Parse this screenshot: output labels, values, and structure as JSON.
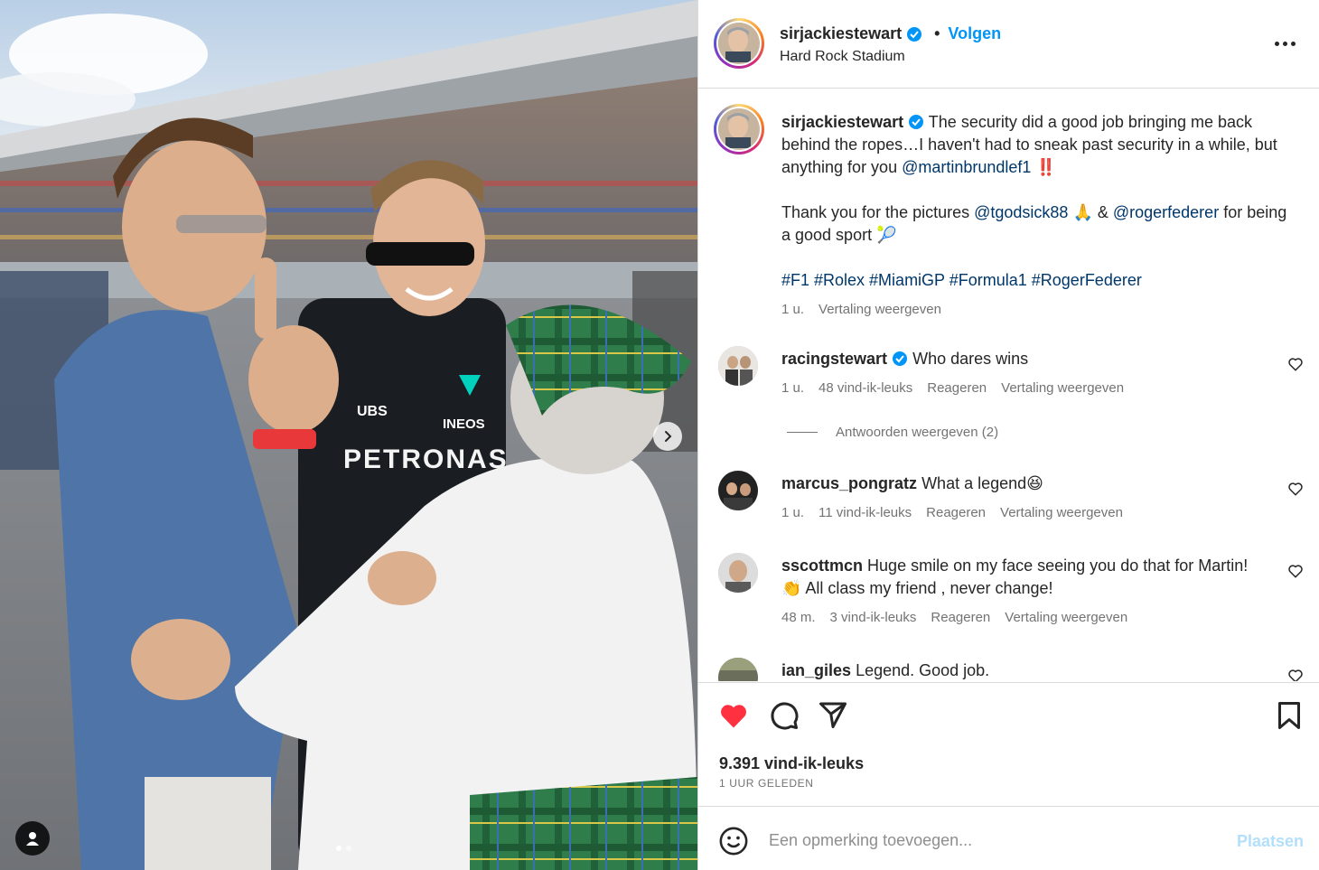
{
  "photo": {
    "jersey_text": "PETRONAS",
    "sponsor_ubs": "UBS",
    "sponsor_ineos": "INEOS",
    "carousel": {
      "count": 2,
      "active": 0
    }
  },
  "header": {
    "username": "sirjackiestewart",
    "separator": "•",
    "follow_label": "Volgen",
    "location": "Hard Rock Stadium"
  },
  "caption": {
    "username": "sirjackiestewart",
    "line1": "The security did a good job bringing me back behind the ropes…I haven't had to sneak past security in a while, but anything for you ",
    "mention1": "@martinbrundlef1",
    "emoji1": "‼️",
    "line2a": "Thank you for the pictures ",
    "mention2": "@tgodsick88",
    "emoji2": " 🙏 & ",
    "mention3": "@rogerfederer",
    "line2b": " for being a good sport 🎾",
    "hashtags": "#F1 #Rolex #MiamiGP #Formula1 #RogerFederer",
    "time": "1 u.",
    "translate": "Vertaling weergeven"
  },
  "comments": [
    {
      "username": "racingstewart",
      "verified": true,
      "text": "Who dares wins",
      "time": "1 u.",
      "likes": "48 vind-ik-leuks",
      "reply": "Reageren",
      "translate": "Vertaling weergeven",
      "replies_label": "Antwoorden weergeven (2)"
    },
    {
      "username": "marcus_pongratz",
      "verified": false,
      "text": "What a legend😆",
      "time": "1 u.",
      "likes": "11 vind-ik-leuks",
      "reply": "Reageren",
      "translate": "Vertaling weergeven"
    },
    {
      "username": "sscottmcn",
      "verified": false,
      "text": "Huge smile on my face seeing you do that for Martin!👏 All class my friend , never change!",
      "time": "48 m.",
      "likes": "3 vind-ik-leuks",
      "reply": "Reageren",
      "translate": "Vertaling weergeven"
    },
    {
      "username": "ian_giles",
      "verified": false,
      "text": "Legend. Good job."
    }
  ],
  "actions": {
    "likes": "9.391 vind-ik-leuks",
    "time": "1 UUR GELEDEN",
    "liked": true
  },
  "add_comment": {
    "placeholder": "Een opmerking toevoegen...",
    "post_label": "Plaatsen"
  },
  "colors": {
    "accent": "#0095f6",
    "mention": "#00376b",
    "heart": "#ff3040",
    "muted": "#737373"
  },
  "icons": [
    "verified-icon",
    "more-icon",
    "heart-icon",
    "comment-icon",
    "share-icon",
    "bookmark-icon",
    "emoji-icon",
    "chevron-right-icon",
    "user-tag-icon"
  ]
}
